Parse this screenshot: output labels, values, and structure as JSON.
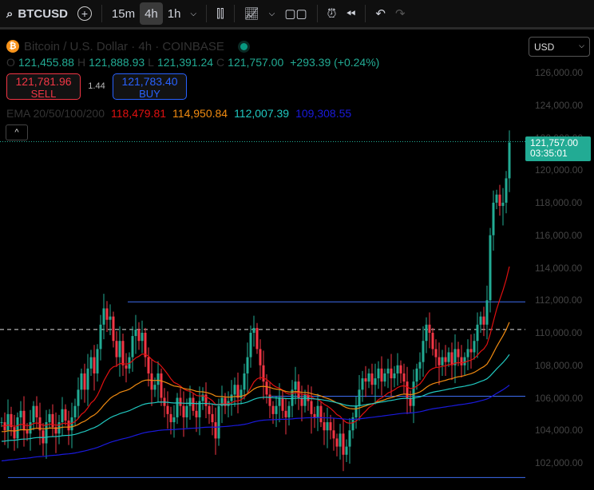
{
  "toolbar": {
    "symbol": "BTCUSD",
    "intervals": [
      "15m",
      "4h",
      "1h"
    ],
    "active_interval": "4h"
  },
  "legend": {
    "title": "Bitcoin / U.S. Dollar · 4h · COINBASE",
    "o_label": "O",
    "o": "121,455.88",
    "h_label": "H",
    "h": "121,888.93",
    "l_label": "L",
    "l": "121,391.24",
    "c_label": "C",
    "c": "121,757.00",
    "change": "+293.39 (+0.24%)",
    "sell_price": "121,781.96",
    "sell_label": "SELL",
    "spread": "1.44",
    "buy_price": "121,783.40",
    "buy_label": "BUY",
    "ema_label": "EMA 20/50/100/200",
    "ema20": "118,479.81",
    "ema50": "114,950.84",
    "ema100": "112,007.39",
    "ema200": "109,308.55"
  },
  "colors": {
    "up": "#22ab94",
    "down": "#f23645",
    "ema20": "#e01010",
    "ema50": "#f08a10",
    "ema100": "#20c8c0",
    "ema200": "#1a1adc",
    "line": "#3d6cf0"
  },
  "axis": {
    "currency": "USD",
    "ticks": [
      "126,000.00",
      "124,000.00",
      "122,000.00",
      "120,000.00",
      "118,000.00",
      "116,000.00",
      "114,000.00",
      "112,000.00",
      "110,000.00",
      "108,000.00",
      "106,000.00",
      "104,000.00",
      "102,000.00"
    ],
    "last_price": "121,757.00",
    "countdown": "03:35:01"
  },
  "chart_data": {
    "type": "candlestick",
    "unit": "thousand USD",
    "ylim": [
      101,
      127
    ],
    "closes": [
      104.5,
      104.0,
      105.0,
      104.2,
      103.5,
      104.8,
      105.2,
      104.0,
      103.8,
      104.5,
      105.5,
      104.8,
      104.0,
      103.2,
      104.5,
      105.0,
      104.2,
      103.8,
      104.5,
      105.3,
      104.6,
      104.0,
      104.8,
      105.5,
      106.5,
      107.5,
      106.5,
      107.8,
      108.5,
      107.5,
      109.0,
      110.5,
      111.5,
      110.8,
      111.0,
      109.5,
      108.5,
      109.5,
      108.0,
      107.8,
      108.5,
      109.8,
      110.2,
      109.5,
      110.0,
      108.5,
      107.5,
      106.5,
      106.8,
      107.5,
      106.0,
      105.5,
      105.0,
      104.5,
      104.8,
      106.0,
      105.5,
      104.8,
      105.5,
      106.0,
      105.2,
      104.8,
      105.8,
      106.2,
      105.5,
      105.0,
      104.5,
      103.5,
      105.5,
      106.0,
      105.5,
      105.8,
      106.2,
      106.8,
      106.0,
      106.5,
      107.5,
      108.5,
      110.0,
      110.3,
      109.0,
      108.0,
      107.0,
      106.2,
      105.5,
      105.0,
      105.5,
      106.0,
      105.2,
      104.8,
      105.5,
      106.5,
      107.0,
      106.0,
      105.5,
      106.2,
      105.8,
      105.0,
      104.8,
      105.5,
      104.5,
      104.0,
      104.5,
      104.0,
      103.5,
      103.0,
      103.8,
      102.5,
      103.0,
      104.0,
      104.8,
      105.5,
      106.5,
      107.2,
      107.0,
      107.5,
      106.8,
      107.2,
      107.8,
      107.0,
      107.5,
      107.8,
      107.2,
      107.5,
      108.0,
      107.5,
      107.0,
      106.0,
      105.5,
      107.0,
      107.8,
      108.2,
      109.5,
      110.5,
      110.0,
      109.0,
      108.5,
      108.0,
      108.5,
      108.2,
      108.8,
      108.0,
      109.0,
      108.5,
      108.0,
      108.5,
      109.0,
      108.8,
      109.5,
      110.5,
      111.0,
      110.5,
      112.0,
      116.0,
      118.0,
      118.5,
      117.8,
      118.0,
      119.5,
      121.7
    ],
    "hlines": [
      111.9,
      110.2,
      106.1,
      100.9
    ]
  }
}
